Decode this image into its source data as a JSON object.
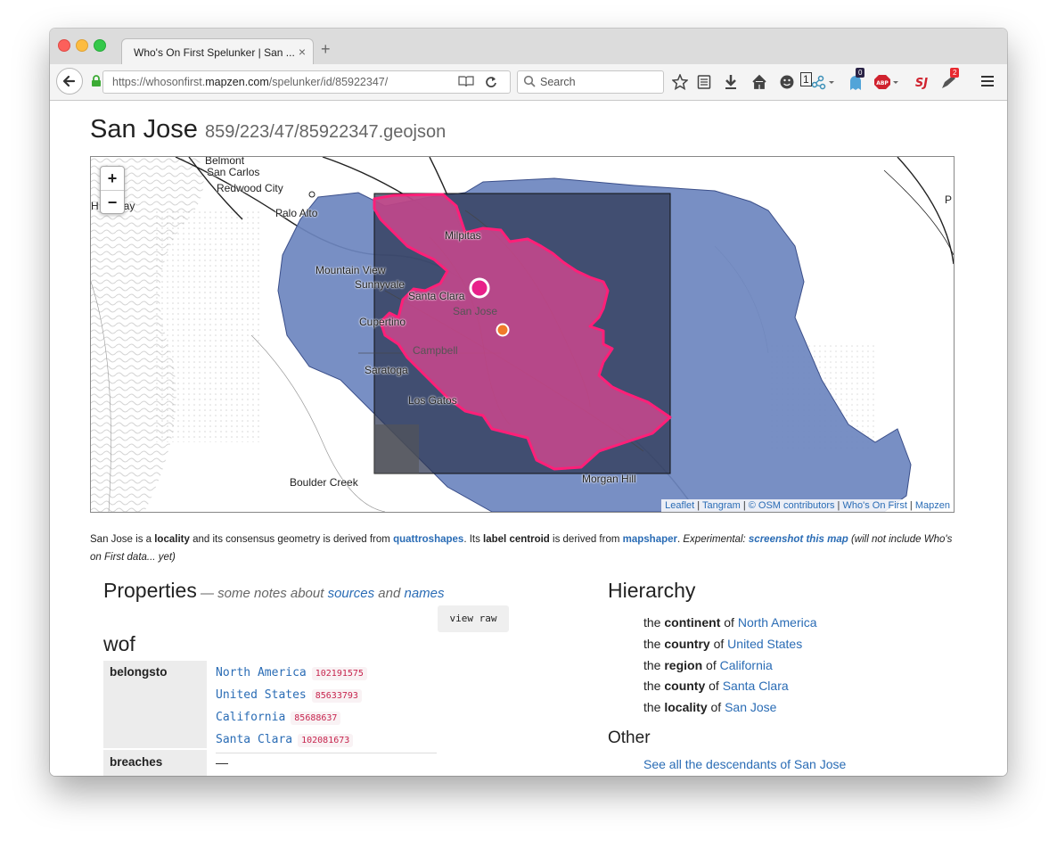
{
  "browser": {
    "tab_title": "Who's On First Spelunker | San ...",
    "url_prefix": "https://whosonfirst.",
    "url_domain": "mapzen.com",
    "url_path": "/spelunker/id/85922347/",
    "search_placeholder": "Search",
    "badges": {
      "ublock": "0",
      "notifications": "2",
      "tab_count": "1"
    }
  },
  "page": {
    "title": "San Jose",
    "subtitle": "859/223/47/85922347.geojson"
  },
  "map": {
    "zoom_in": "+",
    "zoom_out": "−",
    "labels": {
      "belmont": "Belmont",
      "san_carlos": "San Carlos",
      "redwood_city": "Redwood City",
      "hidden_bay": "H      on Bay",
      "palo_alto": "Palo Alto",
      "milpitas": "Milpitas",
      "mountain_view": "Mountain View",
      "sunnyvale": "Sunnyvale",
      "santa_clara": "Santa Clara",
      "san_jose": "San Jose",
      "cupertino": "Cupertino",
      "campbell": "Campbell",
      "saratoga": "Saratoga",
      "los_gatos": "Los Gatos",
      "boulder_creek": "Boulder Creek",
      "morgan_hill": "Morgan Hill",
      "edge_p": "P"
    },
    "attribution": {
      "leaflet": "Leaflet",
      "tangram": "Tangram",
      "osm": "© OSM contributors",
      "wof": "Who's On First",
      "mapzen": "Mapzen"
    },
    "colors": {
      "county_fill": "#6d86bf",
      "bbox_fill": "#2d3550",
      "locality_fill": "#d1478f",
      "locality_stroke": "#ff1f78",
      "centroid_fill": "#e8208a",
      "label_centroid_fill": "#f07a2a"
    }
  },
  "intro": {
    "p1": "San Jose is a ",
    "placetype": "locality",
    "p2": " and its consensus geometry is derived from ",
    "geom_source": "quattroshapes",
    "p3": ". Its ",
    "label_centroid": "label centroid",
    "p4": " is derived from ",
    "centroid_source": "mapshaper",
    "p5": ". ",
    "experimental": "Experimental: ",
    "screenshot": "screenshot this map",
    "note": " (will not include Who's on First data... yet)"
  },
  "properties": {
    "heading": "Properties",
    "note_prefix": " — some notes about ",
    "sources": "sources",
    "and": " and ",
    "names": "names",
    "view_raw": "view raw",
    "group": "wof",
    "rows": [
      {
        "key": "belongsto",
        "items": [
          {
            "name": "North America",
            "id": "102191575"
          },
          {
            "name": "United States",
            "id": "85633793"
          },
          {
            "name": "California",
            "id": "85688637"
          },
          {
            "name": "Santa Clara",
            "id": "102081673"
          }
        ]
      },
      {
        "key": "breaches",
        "value": "—"
      }
    ]
  },
  "hierarchy": {
    "heading": "Hierarchy",
    "the": "the",
    "of": "of",
    "items": [
      {
        "placetype": "continent",
        "name": "North America"
      },
      {
        "placetype": "country",
        "name": "United States"
      },
      {
        "placetype": "region",
        "name": "California"
      },
      {
        "placetype": "county",
        "name": "Santa Clara"
      },
      {
        "placetype": "locality",
        "name": "San Jose"
      }
    ],
    "other_heading": "Other",
    "descendants_link": "See all the descendants of San Jose"
  }
}
